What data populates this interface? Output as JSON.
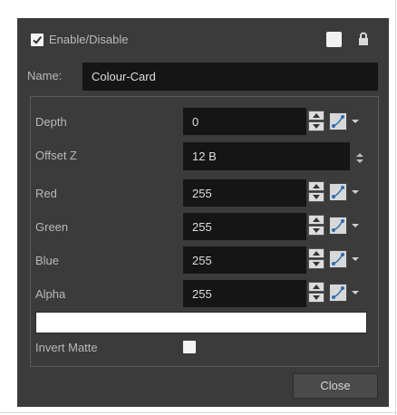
{
  "header": {
    "enable_checked": true,
    "enable_label": "Enable/Disable"
  },
  "name_row": {
    "label": "Name:",
    "value": "Colour-Card"
  },
  "params": [
    {
      "label": "Depth",
      "value": "0"
    },
    {
      "label": "Offset Z",
      "value": "12 B"
    },
    {
      "label": "Red",
      "value": "255"
    },
    {
      "label": "Green",
      "value": "255"
    },
    {
      "label": "Blue",
      "value": "255"
    },
    {
      "label": "Alpha",
      "value": "255"
    }
  ],
  "colour_swatch": "#ffffff",
  "invert_matte": {
    "label": "Invert Matte",
    "checked": false
  },
  "close_button": "Close",
  "icons": [
    "checkbox-checked-icon",
    "color-swatch-icon",
    "lock-icon",
    "spin-up-icon",
    "spin-down-icon",
    "function-curve-icon",
    "dropdown-arrow-icon",
    "sort-arrows-icon"
  ]
}
